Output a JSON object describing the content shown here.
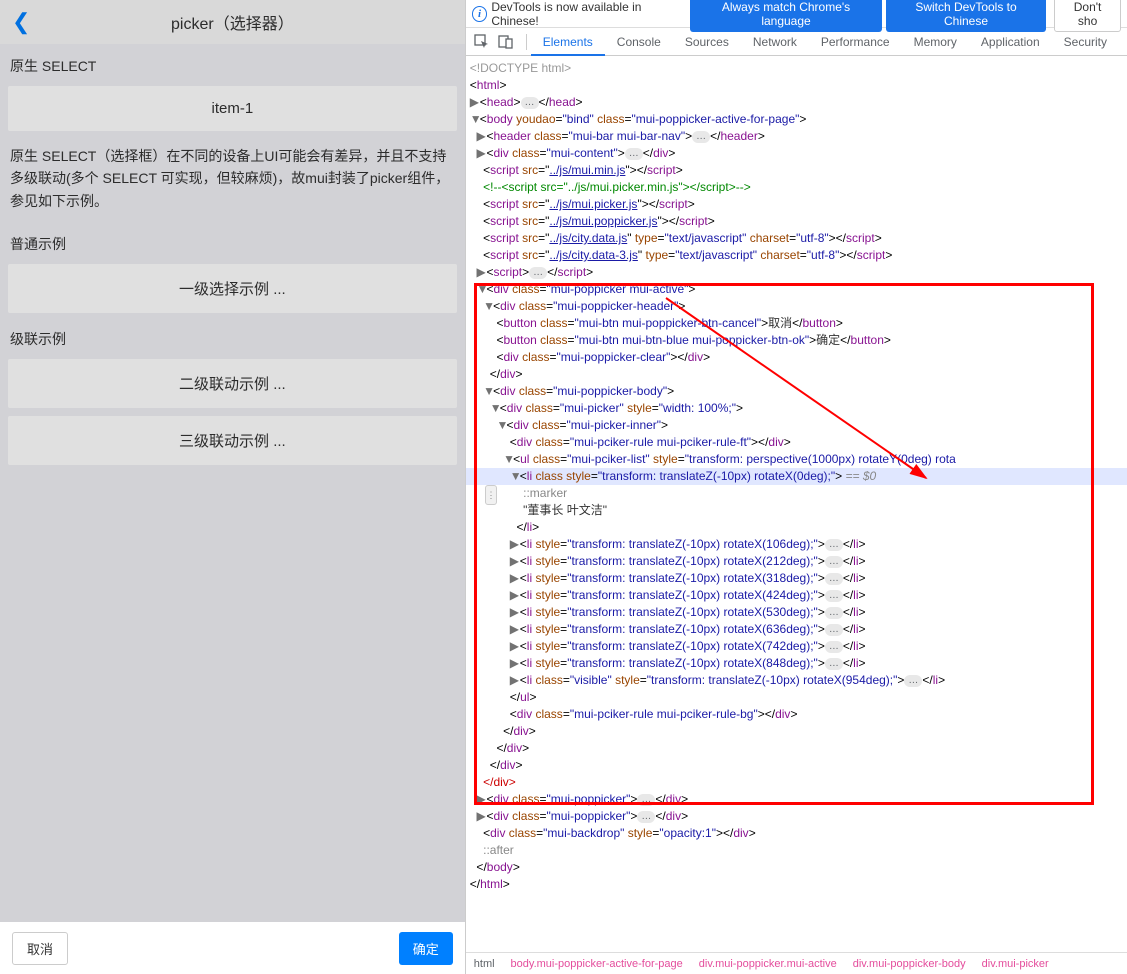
{
  "app": {
    "title": "picker（选择器）",
    "sections": {
      "native_label": "原生 SELECT",
      "native_btn": "item-1",
      "desc": "原生 SELECT（选择框）在不同的设备上UI可能会有差异，并且不支持多级联动(多个 SELECT 可实现，但较麻烦)，故mui封装了picker组件，参见如下示例。",
      "normal_label": "普通示例",
      "normal_btn": "一级选择示例 ...",
      "cascade_label": "级联示例",
      "cascade_btn2": "二级联动示例 ...",
      "cascade_btn3": "三级联动示例 ..."
    },
    "footer": {
      "cancel": "取消",
      "ok": "确定"
    }
  },
  "infobar": {
    "text": "DevTools is now available in Chinese!",
    "btn1": "Always match Chrome's language",
    "btn2": "Switch DevTools to Chinese",
    "btn3": "Don't sho"
  },
  "tabs": [
    "Elements",
    "Console",
    "Sources",
    "Network",
    "Performance",
    "Memory",
    "Application",
    "Security"
  ],
  "active_tab": 0,
  "dom": {
    "doctype": "<!DOCTYPE html>",
    "html_open": "html",
    "head": {
      "tag": "head"
    },
    "body_attrs": "youdao=\"bind\" class=\"mui-poppicker-active-for-page\"",
    "header_attrs": "class=\"mui-bar mui-bar-nav\"",
    "content_attrs": "class=\"mui-content\"",
    "scripts": [
      {
        "src": "../js/mui.min.js"
      },
      {
        "comment": "<!--<script src=\"../js/mui.picker.min.js\"></script-->"
      },
      {
        "src": "../js/mui.picker.js"
      },
      {
        "src": "../js/mui.poppicker.js"
      },
      {
        "src": "../js/city.data.js",
        "extra": " type=\"text/javascript\" charset=\"utf-8\""
      },
      {
        "src": "../js/city.data-3.js",
        "extra": " type=\"text/javascript\" charset=\"utf-8\""
      }
    ],
    "poppicker_class": "mui-poppicker mui-active",
    "pheader_class": "mui-poppicker-header",
    "btn_cancel_cls": "mui-btn mui-poppicker-btn-cancel",
    "btn_cancel_txt": "取消",
    "btn_ok_cls": "mui-btn mui-btn-blue mui-poppicker-btn-ok",
    "btn_ok_txt": "确定",
    "clear_cls": "mui-poppicker-clear",
    "pbody_class": "mui-poppicker-body",
    "picker_cls": "mui-picker",
    "picker_style": "width: 100%;",
    "inner_cls": "mui-picker-inner",
    "rule_ft_cls": "mui-pciker-rule mui-pciker-rule-ft",
    "ul_cls": "mui-pciker-list",
    "ul_style": "transform: perspective(1000px) rotateY(0deg) rota",
    "li0_style": "transform: translateZ(-10px) rotateX(0deg);",
    "li0_marker": "::marker",
    "li0_text": "\"董事长 叶文洁\"",
    "li_styles": [
      "transform: translateZ(-10px) rotateX(106deg);",
      "transform: translateZ(-10px) rotateX(212deg);",
      "transform: translateZ(-10px) rotateX(318deg);",
      "transform: translateZ(-10px) rotateX(424deg);",
      "transform: translateZ(-10px) rotateX(530deg);",
      "transform: translateZ(-10px) rotateX(636deg);",
      "transform: translateZ(-10px) rotateX(742deg);",
      "transform: translateZ(-10px) rotateX(848deg);"
    ],
    "li_visible_cls": "visible",
    "li_visible_style": "transform: translateZ(-10px) rotateX(954deg);",
    "rule_bg_cls": "mui-pciker-rule mui-pciker-rule-bg",
    "pop2_cls": "mui-poppicker",
    "backdrop_cls": "mui-backdrop",
    "backdrop_style": "opacity:1",
    "after": "::after",
    "selmark": " == $0"
  },
  "crumbs": [
    "html",
    "body.mui-poppicker-active-for-page",
    "div.mui-poppicker.mui-active",
    "div.mui-poppicker-body",
    "div.mui-picker"
  ]
}
